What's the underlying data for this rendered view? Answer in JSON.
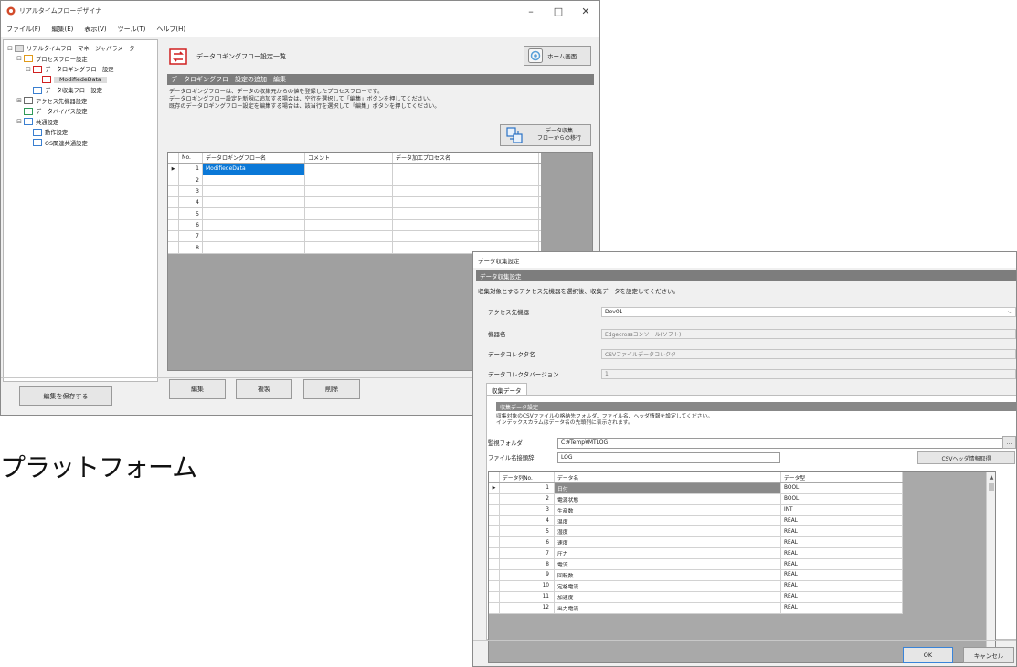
{
  "main_window": {
    "title": "リアルタイムフローデザイナ",
    "controls": {
      "minimize": "–",
      "maximize": "□",
      "close": "✕"
    },
    "menu": [
      "ファイル(F)",
      "編集(E)",
      "表示(V)",
      "ツール(T)",
      "ヘルプ(H)"
    ],
    "tree": [
      {
        "exp": "⊟",
        "label": "リアルタイムフローマネージャパラメータ",
        "indent": 0,
        "icon": "folder-icon"
      },
      {
        "exp": "⊟",
        "label": "プロセスフロー設定",
        "indent": 1,
        "icon": "process-icon"
      },
      {
        "exp": "⊟",
        "label": "データロギングフロー設定",
        "indent": 2,
        "icon": "logging-icon"
      },
      {
        "exp": "",
        "label": "ModifiedeData",
        "indent": 3,
        "icon": "flow-icon",
        "selected": true
      },
      {
        "exp": "",
        "label": "データ収集フロー設定",
        "indent": 2,
        "icon": "collect-icon"
      },
      {
        "exp": "⊞",
        "label": "アクセス先機器設定",
        "indent": 1,
        "icon": "device-icon"
      },
      {
        "exp": "",
        "label": "データバイパス設定",
        "indent": 1,
        "icon": "bypass-icon"
      },
      {
        "exp": "⊟",
        "label": "共通設定",
        "indent": 1,
        "icon": "common-icon"
      },
      {
        "exp": "",
        "label": "動作設定",
        "indent": 2,
        "icon": "gear-small-icon"
      },
      {
        "exp": "",
        "label": "OS関連共通設定",
        "indent": 2,
        "icon": "gear-small-icon"
      }
    ],
    "header_title": "データロギングフロー設定一覧",
    "home_button": "ホーム画面",
    "section_title": "データロギングフロー設定の追加・編集",
    "description": [
      "データロギングフローは、データの収集元からの値を登録したプロセスフローです。",
      "データロギングフロー設定を新規に追加する場合は、空行を選択して「編集」ボタンを押してください。",
      "既存のデータロギングフロー設定を編集する場合は、該当行を選択して「編集」ボタンを押してください。"
    ],
    "map_button": [
      "データ収集",
      "フローからの移行"
    ],
    "grid_headers": [
      "No.",
      "データロギングフロー名",
      "コメント",
      "データ加工プロセス名"
    ],
    "grid_rows": [
      {
        "no": "1",
        "name": "ModifiedeData",
        "comment": "",
        "process": "",
        "selected": true
      },
      {
        "no": "2",
        "name": "",
        "comment": "",
        "process": ""
      },
      {
        "no": "3",
        "name": "",
        "comment": "",
        "process": ""
      },
      {
        "no": "4",
        "name": "",
        "comment": "",
        "process": ""
      },
      {
        "no": "5",
        "name": "",
        "comment": "",
        "process": ""
      },
      {
        "no": "6",
        "name": "",
        "comment": "",
        "process": ""
      },
      {
        "no": "7",
        "name": "",
        "comment": "",
        "process": ""
      },
      {
        "no": "8",
        "name": "",
        "comment": "",
        "process": ""
      }
    ],
    "buttons": {
      "edit": "編集",
      "copy": "複製",
      "delete": "削除"
    },
    "footer_button": "編集を保存する"
  },
  "platform_text": "プラットフォーム",
  "dialog": {
    "title": "データ収集設定",
    "section": "データ収集設定",
    "instruction": "収集対象とするアクセス先機器を選択後、収集データを設定してください。",
    "fields": [
      {
        "label": "アクセス先機器",
        "value": "Dev01",
        "dropdown": true,
        "white": true
      },
      {
        "label": "機器名",
        "value": "Edgecrossコンソール(ソフト)",
        "white": false
      },
      {
        "label": "データコレクタ名",
        "value": "CSVファイルデータコレクタ",
        "white": false
      },
      {
        "label": "データコレクタバージョン",
        "value": "1",
        "white": false
      }
    ],
    "tab": "収集データ",
    "sub_section": "収集データ設定",
    "sub_desc": [
      "収集対象のCSVファイルの格納先フォルダ、ファイル名、ヘッダ情報を設定してください。",
      "インデックスカラムはデータ名の先頭列に表示されます。"
    ],
    "folder_label": "監視フォルダ",
    "folder_value": "C:¥Temp¥MTLOG",
    "folder_browse": "...",
    "file_label": "ファイル名接頭辞",
    "file_value": "LOG",
    "header_button": "CSVヘッダ情報取得",
    "grid_headers": [
      "データ列No.",
      "データ名",
      "データ型"
    ],
    "grid_rows": [
      {
        "no": "1",
        "name": "日付",
        "type": "BOOL",
        "selected": true
      },
      {
        "no": "2",
        "name": "電源状態",
        "type": "BOOL"
      },
      {
        "no": "3",
        "name": "生産数",
        "type": "INT"
      },
      {
        "no": "4",
        "name": "温度",
        "type": "REAL"
      },
      {
        "no": "5",
        "name": "湿度",
        "type": "REAL"
      },
      {
        "no": "6",
        "name": "速度",
        "type": "REAL"
      },
      {
        "no": "7",
        "name": "圧力",
        "type": "REAL"
      },
      {
        "no": "8",
        "name": "電流",
        "type": "REAL"
      },
      {
        "no": "9",
        "name": "回転数",
        "type": "REAL"
      },
      {
        "no": "10",
        "name": "定格電流",
        "type": "REAL"
      },
      {
        "no": "11",
        "name": "加速度",
        "type": "REAL"
      },
      {
        "no": "12",
        "name": "出力電流",
        "type": "REAL"
      }
    ],
    "ok": "OK",
    "cancel": "キャンセル"
  }
}
